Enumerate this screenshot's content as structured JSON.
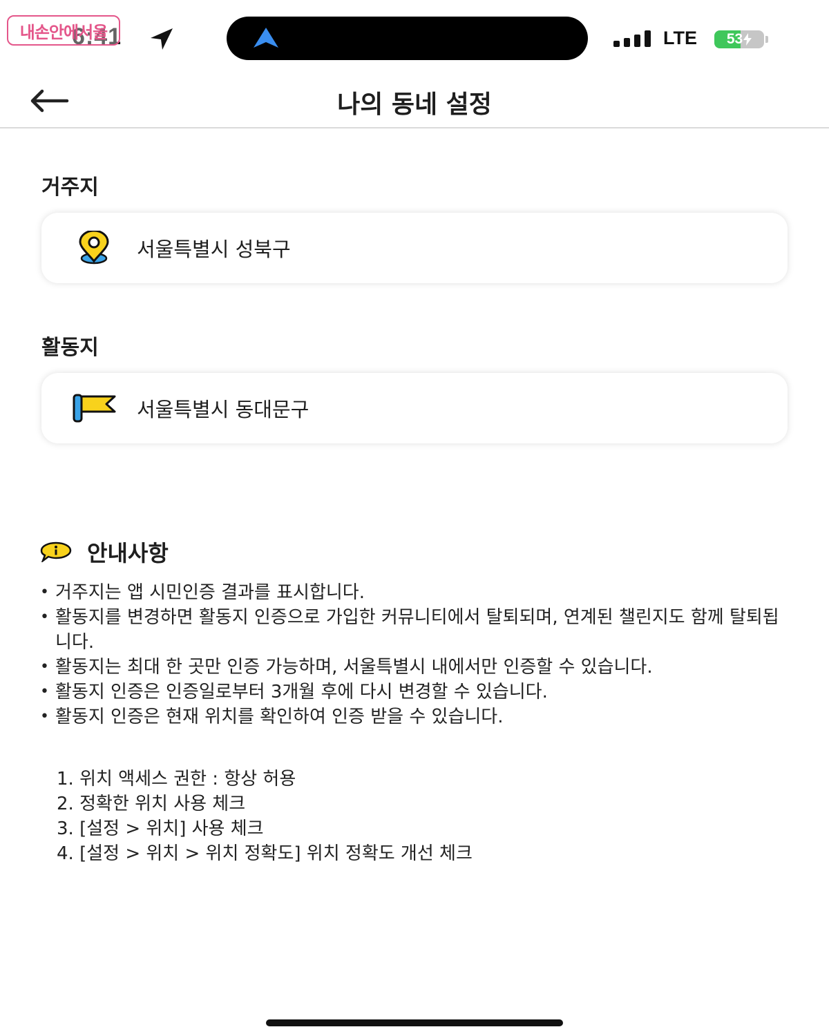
{
  "watermark": "내손안에서울",
  "status_bar": {
    "time": "6:41",
    "network": "LTE",
    "battery_percent": 53,
    "battery_label": "53",
    "battery_fill_color": "#3fc75b",
    "island_icon": "navigation-arrow-icon"
  },
  "header": {
    "title": "나의 동네 설정",
    "back_icon": "back-arrow-icon"
  },
  "residence": {
    "label": "거주지",
    "value": "서울특별시 성북구",
    "icon": "location-pin-icon"
  },
  "activity": {
    "label": "활동지",
    "value": "서울특별시 동대문구",
    "icon": "flag-icon"
  },
  "notice": {
    "title": "안내사항",
    "icon": "info-bubble-icon",
    "items": [
      "거주지는 앱 시민인증 결과를 표시합니다.",
      "활동지를 변경하면 활동지 인증으로 가입한 커뮤니티에서 탈퇴되며, 연계된 챌린지도 함께 탈퇴됩니다.",
      "활동지는 최대 한 곳만 인증 가능하며, 서울특별시 내에서만 인증할 수 있습니다.",
      "활동지 인증은 인증일로부터 3개월 후에 다시 변경할 수 있습니다.",
      "활동지 인증은 현재 위치를 확인하여 인증 받을 수 있습니다."
    ],
    "steps": [
      "1. 위치 액세스 권한 : 항상 허용",
      "2. 정확한 위치 사용 체크",
      "3. [설정 > 위치] 사용 체크",
      "4. [설정 > 위치 > 위치 정확도] 위치 정확도 개선 체크"
    ]
  },
  "colors": {
    "accent_yellow": "#f8d21c",
    "accent_blue": "#3aa3e8",
    "watermark_pink": "#e4568a"
  }
}
